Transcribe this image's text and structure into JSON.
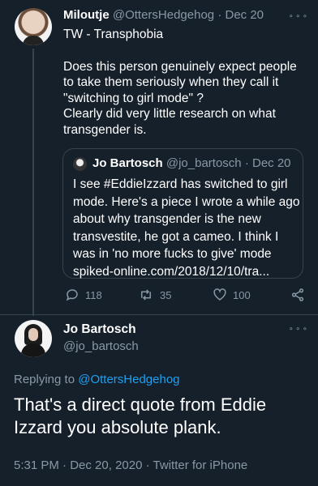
{
  "parent_tweet": {
    "display_name": "Miloutje",
    "handle": "@OttersHedgehog",
    "separator": "·",
    "date": "Dec 20",
    "content_warning": "TW - Transphobia",
    "body": "Does this person genuinely expect people to take them seriously when they call it \"switching to girl mode\" ?\nClearly did very little research on what transgender is.",
    "quoted": {
      "display_name": "Jo Bartosch",
      "handle": "@jo_bartosch",
      "separator": "·",
      "date": "Dec 20",
      "body": "I see #EddieIzzard has switched to girl mode. Here's a piece I wrote a while ago about why transgender is the new transvestite, he got a cameo. I think I was in 'no more fucks to give' mode spiked-online.com/2018/12/10/tra..."
    },
    "actions": {
      "replies": "118",
      "retweets": "35",
      "likes": "100"
    }
  },
  "main_tweet": {
    "display_name": "Jo Bartosch",
    "handle": "@jo_bartosch",
    "replying_prefix": "Replying to",
    "replying_to": "@OttersHedgehog",
    "text": "That's a direct quote from Eddie Izzard you absolute plank.",
    "time": "5:31 PM",
    "date": "Dec 20, 2020",
    "source": "Twitter for iPhone",
    "separator": "·"
  },
  "icons": [
    "more-icon",
    "reply-icon",
    "retweet-icon",
    "like-icon",
    "share-icon"
  ],
  "colors": {
    "background": "#15202b",
    "muted": "#8899a6",
    "accent": "#1da1f2",
    "border": "#38444d"
  }
}
